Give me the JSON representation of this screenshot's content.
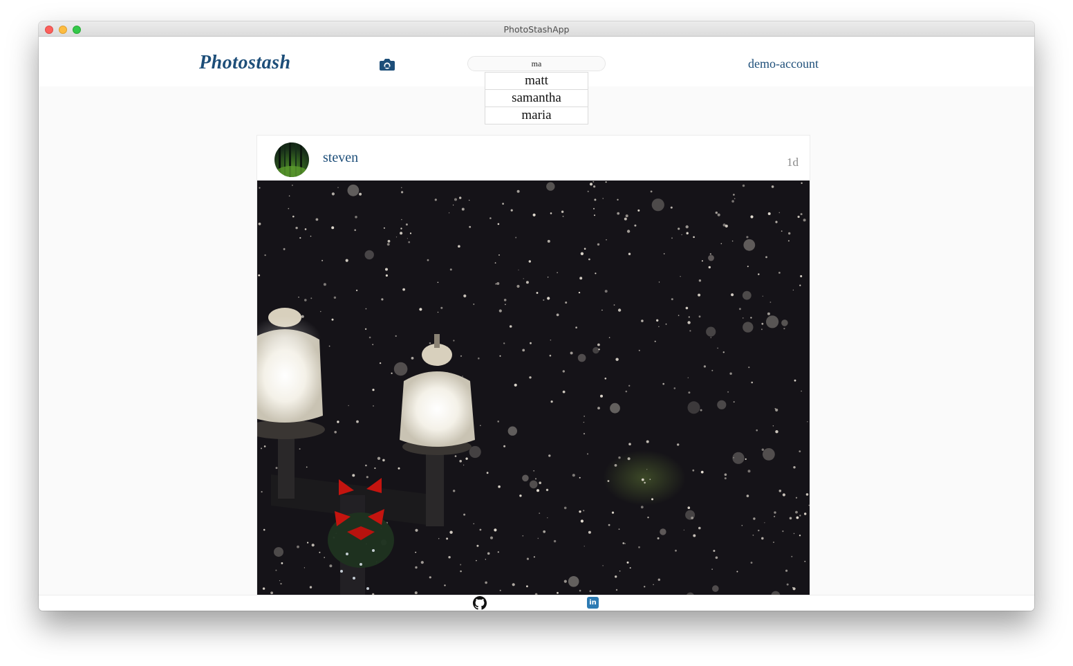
{
  "window": {
    "title": "PhotoStashApp"
  },
  "header": {
    "logo": "Photostash",
    "camera_icon": "camera-icon",
    "search": {
      "value": "ma",
      "placeholder": ""
    },
    "account": "demo-account"
  },
  "search_suggestions": [
    "matt",
    "samantha",
    "maria"
  ],
  "post": {
    "username": "steven",
    "time": "1d",
    "photo": "snowy night street lamps"
  },
  "footer": {
    "github_icon": "github-icon",
    "linkedin_icon": "linkedin-icon",
    "linkedin_glyph": "in"
  },
  "colors": {
    "brand": "#1d4e79",
    "page_bg": "#fafafa",
    "linkedin": "#2d7bb3"
  }
}
